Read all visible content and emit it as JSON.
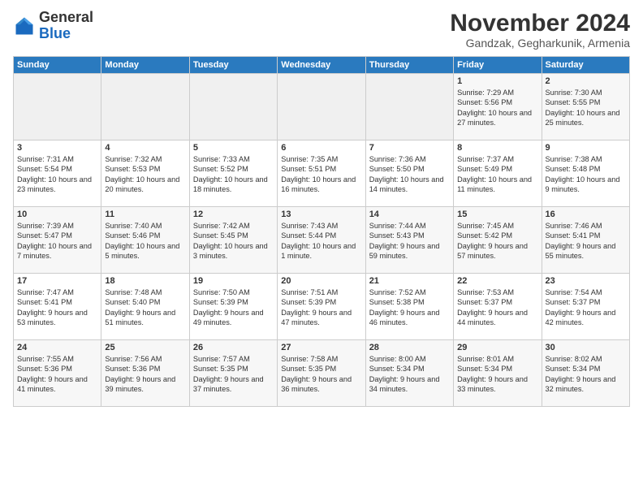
{
  "header": {
    "logo_general": "General",
    "logo_blue": "Blue",
    "month_title": "November 2024",
    "location": "Gandzak, Gegharkunik, Armenia"
  },
  "columns": [
    "Sunday",
    "Monday",
    "Tuesday",
    "Wednesday",
    "Thursday",
    "Friday",
    "Saturday"
  ],
  "weeks": [
    [
      {
        "day": "",
        "text": ""
      },
      {
        "day": "",
        "text": ""
      },
      {
        "day": "",
        "text": ""
      },
      {
        "day": "",
        "text": ""
      },
      {
        "day": "",
        "text": ""
      },
      {
        "day": "1",
        "text": "Sunrise: 7:29 AM\nSunset: 5:56 PM\nDaylight: 10 hours and 27 minutes."
      },
      {
        "day": "2",
        "text": "Sunrise: 7:30 AM\nSunset: 5:55 PM\nDaylight: 10 hours and 25 minutes."
      }
    ],
    [
      {
        "day": "3",
        "text": "Sunrise: 7:31 AM\nSunset: 5:54 PM\nDaylight: 10 hours and 23 minutes."
      },
      {
        "day": "4",
        "text": "Sunrise: 7:32 AM\nSunset: 5:53 PM\nDaylight: 10 hours and 20 minutes."
      },
      {
        "day": "5",
        "text": "Sunrise: 7:33 AM\nSunset: 5:52 PM\nDaylight: 10 hours and 18 minutes."
      },
      {
        "day": "6",
        "text": "Sunrise: 7:35 AM\nSunset: 5:51 PM\nDaylight: 10 hours and 16 minutes."
      },
      {
        "day": "7",
        "text": "Sunrise: 7:36 AM\nSunset: 5:50 PM\nDaylight: 10 hours and 14 minutes."
      },
      {
        "day": "8",
        "text": "Sunrise: 7:37 AM\nSunset: 5:49 PM\nDaylight: 10 hours and 11 minutes."
      },
      {
        "day": "9",
        "text": "Sunrise: 7:38 AM\nSunset: 5:48 PM\nDaylight: 10 hours and 9 minutes."
      }
    ],
    [
      {
        "day": "10",
        "text": "Sunrise: 7:39 AM\nSunset: 5:47 PM\nDaylight: 10 hours and 7 minutes."
      },
      {
        "day": "11",
        "text": "Sunrise: 7:40 AM\nSunset: 5:46 PM\nDaylight: 10 hours and 5 minutes."
      },
      {
        "day": "12",
        "text": "Sunrise: 7:42 AM\nSunset: 5:45 PM\nDaylight: 10 hours and 3 minutes."
      },
      {
        "day": "13",
        "text": "Sunrise: 7:43 AM\nSunset: 5:44 PM\nDaylight: 10 hours and 1 minute."
      },
      {
        "day": "14",
        "text": "Sunrise: 7:44 AM\nSunset: 5:43 PM\nDaylight: 9 hours and 59 minutes."
      },
      {
        "day": "15",
        "text": "Sunrise: 7:45 AM\nSunset: 5:42 PM\nDaylight: 9 hours and 57 minutes."
      },
      {
        "day": "16",
        "text": "Sunrise: 7:46 AM\nSunset: 5:41 PM\nDaylight: 9 hours and 55 minutes."
      }
    ],
    [
      {
        "day": "17",
        "text": "Sunrise: 7:47 AM\nSunset: 5:41 PM\nDaylight: 9 hours and 53 minutes."
      },
      {
        "day": "18",
        "text": "Sunrise: 7:48 AM\nSunset: 5:40 PM\nDaylight: 9 hours and 51 minutes."
      },
      {
        "day": "19",
        "text": "Sunrise: 7:50 AM\nSunset: 5:39 PM\nDaylight: 9 hours and 49 minutes."
      },
      {
        "day": "20",
        "text": "Sunrise: 7:51 AM\nSunset: 5:39 PM\nDaylight: 9 hours and 47 minutes."
      },
      {
        "day": "21",
        "text": "Sunrise: 7:52 AM\nSunset: 5:38 PM\nDaylight: 9 hours and 46 minutes."
      },
      {
        "day": "22",
        "text": "Sunrise: 7:53 AM\nSunset: 5:37 PM\nDaylight: 9 hours and 44 minutes."
      },
      {
        "day": "23",
        "text": "Sunrise: 7:54 AM\nSunset: 5:37 PM\nDaylight: 9 hours and 42 minutes."
      }
    ],
    [
      {
        "day": "24",
        "text": "Sunrise: 7:55 AM\nSunset: 5:36 PM\nDaylight: 9 hours and 41 minutes."
      },
      {
        "day": "25",
        "text": "Sunrise: 7:56 AM\nSunset: 5:36 PM\nDaylight: 9 hours and 39 minutes."
      },
      {
        "day": "26",
        "text": "Sunrise: 7:57 AM\nSunset: 5:35 PM\nDaylight: 9 hours and 37 minutes."
      },
      {
        "day": "27",
        "text": "Sunrise: 7:58 AM\nSunset: 5:35 PM\nDaylight: 9 hours and 36 minutes."
      },
      {
        "day": "28",
        "text": "Sunrise: 8:00 AM\nSunset: 5:34 PM\nDaylight: 9 hours and 34 minutes."
      },
      {
        "day": "29",
        "text": "Sunrise: 8:01 AM\nSunset: 5:34 PM\nDaylight: 9 hours and 33 minutes."
      },
      {
        "day": "30",
        "text": "Sunrise: 8:02 AM\nSunset: 5:34 PM\nDaylight: 9 hours and 32 minutes."
      }
    ]
  ]
}
